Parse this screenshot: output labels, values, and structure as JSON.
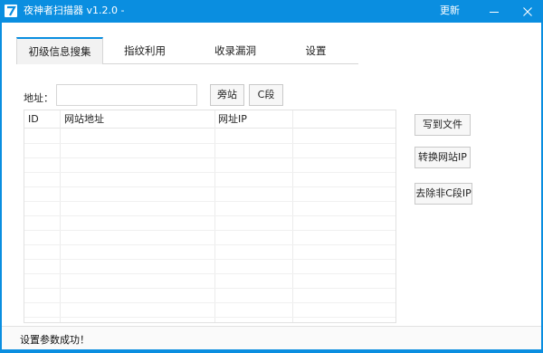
{
  "window": {
    "title": "夜神者扫描器 v1.2.0 -",
    "update_label": "更新"
  },
  "tabs": [
    {
      "label": "初级信息搜集",
      "active": true
    },
    {
      "label": "指纹利用",
      "active": false
    },
    {
      "label": "收录漏洞",
      "active": false
    },
    {
      "label": "设置",
      "active": false
    }
  ],
  "address": {
    "label": "地址：",
    "value": "",
    "placeholder": "",
    "side_station_button": "旁站",
    "c_segment_button": "C段"
  },
  "table": {
    "columns": [
      "ID",
      "网站地址",
      "网址IP"
    ]
  },
  "actions": {
    "write_file": "写到文件",
    "convert_ip": "转换网站IP",
    "remove_non_c": "去除非C段IP"
  },
  "status": {
    "message": "设置参数成功！"
  },
  "colors": {
    "accent": "#0a8ee0"
  }
}
